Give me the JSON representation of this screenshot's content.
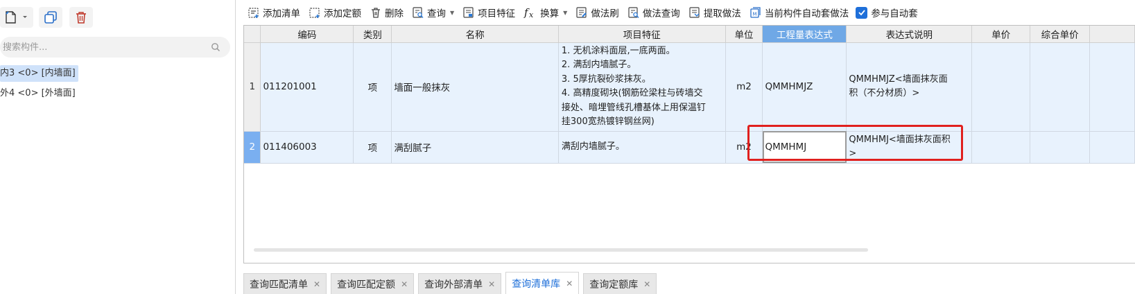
{
  "left_panel": {
    "search": {
      "placeholder": "搜索构件..."
    },
    "tree": [
      {
        "label": "内3 <0> [内墙面]",
        "selected": true
      },
      {
        "label": "外4 <0> [外墙面]",
        "selected": false
      }
    ]
  },
  "toolbar": {
    "add_list": "添加清单",
    "add_quota": "添加定额",
    "delete": "删除",
    "query": "查询",
    "item_feature": "项目特征",
    "convert": "换算",
    "method_brush": "做法刷",
    "method_query": "做法查询",
    "extract_method": "提取做法",
    "auto_apply": "当前构件自动套做法",
    "join_auto": "参与自动套",
    "join_auto_checked": true
  },
  "grid": {
    "columns": [
      "编码",
      "类别",
      "名称",
      "项目特征",
      "单位",
      "工程量表达式",
      "表达式说明",
      "单价",
      "综合单价"
    ],
    "active_column": "工程量表达式",
    "rows": [
      {
        "num": "1",
        "code": "011201001",
        "category": "项",
        "name": "墙面一般抹灰",
        "features": [
          "1. 无机涂料面层,一底两面。",
          "2. 满刮内墙腻子。",
          "3. 5厚抗裂砂浆抹灰。",
          "4. 高精度砌块(钢筋砼梁柱与砖墙交",
          "接处、暗埋管线孔槽基体上用保温钉",
          "挂300宽热镀锌钢丝网)"
        ],
        "unit": "m2",
        "expression": "QMMHMJZ",
        "note_lines": [
          "QMMHMJZ<墙面抹灰面",
          "积（不分材质）>"
        ],
        "price": "",
        "total_price": ""
      },
      {
        "num": "2",
        "code": "011406003",
        "category": "项",
        "name": "满刮腻子",
        "features": [
          "满刮内墙腻子。"
        ],
        "unit": "m2",
        "expression": "QMMHMJ",
        "note_lines": [
          "QMMHMJ<墙面抹灰面积",
          ">"
        ],
        "price": "",
        "total_price": ""
      }
    ]
  },
  "tabs": [
    {
      "label": "查询匹配清单",
      "active": false
    },
    {
      "label": "查询匹配定额",
      "active": false
    },
    {
      "label": "查询外部清单",
      "active": false
    },
    {
      "label": "查询清单库",
      "active": true
    },
    {
      "label": "查询定额库",
      "active": false
    }
  ],
  "colors": {
    "accent": "#1e6fd9",
    "highlight_border": "#e0201e",
    "active_header": "#6fa8e6",
    "row_bg": "#e8f2fd"
  }
}
